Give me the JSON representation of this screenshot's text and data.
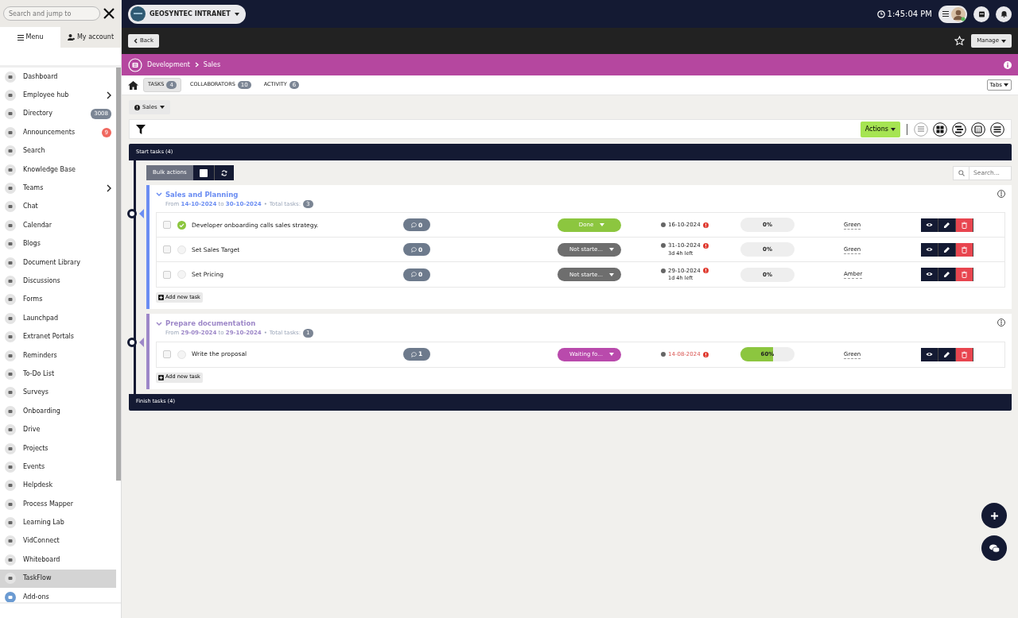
{
  "sidebar": {
    "search": {
      "placeholder": "Search and jump to"
    },
    "tabs": [
      {
        "label": "Menu",
        "selected": true
      },
      {
        "label": "My account",
        "selected": false
      }
    ],
    "items": [
      {
        "label": "Dashboard",
        "selected": false,
        "has_children": false
      },
      {
        "label": "Employee hub",
        "selected": false,
        "has_children": true
      },
      {
        "label": "Directory",
        "selected": false,
        "has_children": false,
        "badge": {
          "text": "3008",
          "color": "#7b8594"
        }
      },
      {
        "label": "Announcements",
        "selected": false,
        "has_children": false,
        "badge": {
          "text": "9",
          "color": "#f0685f"
        }
      },
      {
        "label": "Search",
        "selected": false,
        "has_children": false
      },
      {
        "label": "Knowledge Base",
        "selected": false,
        "has_children": false
      },
      {
        "label": "Teams",
        "selected": false,
        "has_children": true
      },
      {
        "label": "Chat",
        "selected": false,
        "has_children": false
      },
      {
        "label": "Calendar",
        "selected": false,
        "has_children": false
      },
      {
        "label": "Blogs",
        "selected": false,
        "has_children": false
      },
      {
        "label": "Document Library",
        "selected": false,
        "has_children": false
      },
      {
        "label": "Discussions",
        "selected": false,
        "has_children": false
      },
      {
        "label": "Forms",
        "selected": false,
        "has_children": false
      },
      {
        "label": "Launchpad",
        "selected": false,
        "has_children": false
      },
      {
        "label": "Extranet Portals",
        "selected": false,
        "has_children": false
      },
      {
        "label": "Reminders",
        "selected": false,
        "has_children": false
      },
      {
        "label": "To-Do List",
        "selected": false,
        "has_children": false
      },
      {
        "label": "Surveys",
        "selected": false,
        "has_children": false
      },
      {
        "label": "Onboarding",
        "selected": false,
        "has_children": false
      },
      {
        "label": "Drive",
        "selected": false,
        "has_children": false
      },
      {
        "label": "Projects",
        "selected": false,
        "has_children": false
      },
      {
        "label": "Events",
        "selected": false,
        "has_children": false
      },
      {
        "label": "Helpdesk",
        "selected": false,
        "has_children": false
      },
      {
        "label": "Process Mapper",
        "selected": false,
        "has_children": false
      },
      {
        "label": "Learning Lab",
        "selected": false,
        "has_children": false
      },
      {
        "label": "VidConnect",
        "selected": false,
        "has_children": false
      },
      {
        "label": "Whiteboard",
        "selected": false,
        "has_children": false
      },
      {
        "label": "TaskFlow",
        "selected": true,
        "has_children": false
      },
      {
        "label": "Add-ons",
        "selected": false,
        "has_children": false
      }
    ]
  },
  "topbar": {
    "brand": "GEOSYNTEC INTRANET",
    "time": "1:45:04 PM"
  },
  "actionbar": {
    "back": "Back",
    "manage": "Manage"
  },
  "breadcrumb": [
    "Development",
    "Sales"
  ],
  "tabs": [
    {
      "label": "TASKS",
      "count": "4",
      "selected": true
    },
    {
      "label": "COLLABORATORS",
      "count": "10",
      "selected": false
    },
    {
      "label": "ACTIVITY",
      "count": "6",
      "selected": false
    }
  ],
  "tabs_menu": "Tabs",
  "filter_dropdown": "Sales",
  "actions_button": "Actions",
  "views": [
    {
      "kind": "list",
      "selected": false
    },
    {
      "kind": "grid",
      "selected": true
    },
    {
      "kind": "gantt",
      "selected": true
    },
    {
      "kind": "calendar",
      "selected": true
    },
    {
      "kind": "menu",
      "selected": true
    }
  ],
  "start_section": "Start tasks (4)",
  "bulk_actions": "Bulk actions",
  "task_search": {
    "placeholder": "Search..."
  },
  "groups": [
    {
      "title": "Sales and Planning",
      "color": "#6b8df2",
      "from_label": "From",
      "from": "14-10-2024",
      "to_label": "to",
      "to": "30-10-2024",
      "separator": "•",
      "total_label": "Total tasks:",
      "total": "3",
      "add_label": "Add new task",
      "tasks": [
        {
          "title": "Developer onboarding calls sales strategy.",
          "checked": false,
          "done": true,
          "comments": "0",
          "status": {
            "label": "Done",
            "color": "#8cc63f"
          },
          "due": "16-10-2024",
          "overdue": false,
          "level": 0,
          "reading": "0%",
          "rag": "Green"
        },
        {
          "title": "Set Sales Target",
          "checked": false,
          "done": false,
          "comments": "0",
          "status": {
            "label": "Not starte...",
            "color": "#6e6e6e"
          },
          "due": "31-10-2024",
          "overdue": false,
          "time_left": "3d 4h left",
          "level": 0,
          "reading": "0%",
          "rag": "Green"
        },
        {
          "title": "Set Pricing",
          "checked": false,
          "done": false,
          "comments": "0",
          "status": {
            "label": "Not starte...",
            "color": "#6e6e6e"
          },
          "due": "29-10-2024",
          "overdue": false,
          "time_left": "1d 4h left",
          "level": 0,
          "reading": "0%",
          "rag": "Amber"
        }
      ]
    },
    {
      "title": "Prepare documentation",
      "color": "#9d87c8",
      "from_label": "From",
      "from": "29-09-2024",
      "to_label": "to",
      "to": "29-10-2024",
      "separator": "•",
      "total_label": "Total tasks:",
      "total": "1",
      "add_label": "Add new task",
      "tasks": [
        {
          "title": "Write the proposal",
          "checked": false,
          "done": false,
          "comments": "1",
          "status": {
            "label": "Waiting fo...",
            "color": "#b94aac"
          },
          "due": "14-08-2024",
          "overdue": true,
          "level": 0.6,
          "reading": "60%",
          "rag": "Green"
        }
      ]
    }
  ],
  "finish_section": "Finish tasks (4)"
}
